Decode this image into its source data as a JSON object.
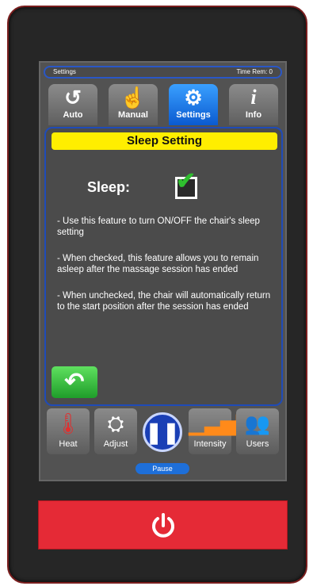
{
  "status": {
    "left": "Settings",
    "right": "Time Rem: 0"
  },
  "tabs": [
    {
      "label": "Auto",
      "icon": "refresh-icon"
    },
    {
      "label": "Manual",
      "icon": "hand-icon"
    },
    {
      "label": "Settings",
      "icon": "gear-icon"
    },
    {
      "label": "Info",
      "icon": "info-icon"
    }
  ],
  "panel": {
    "title": "Sleep Setting",
    "sleep_label": "Sleep:",
    "sleep_checked": true,
    "desc1": "- Use this feature to turn ON/OFF the chair's sleep setting",
    "desc2": "- When checked, this feature allows you to remain asleep after the massage session has ended",
    "desc3": "- When unchecked, the chair will automatically return to the start position after the session has ended"
  },
  "bottom": {
    "heat": "Heat",
    "adjust": "Adjust",
    "pause": "Pause",
    "intensity": "Intensity",
    "users": "Users"
  },
  "colors": {
    "accent": "#1a3fb5",
    "title": "#ffee00",
    "power": "#e52a36",
    "check": "#2fbf2f"
  }
}
